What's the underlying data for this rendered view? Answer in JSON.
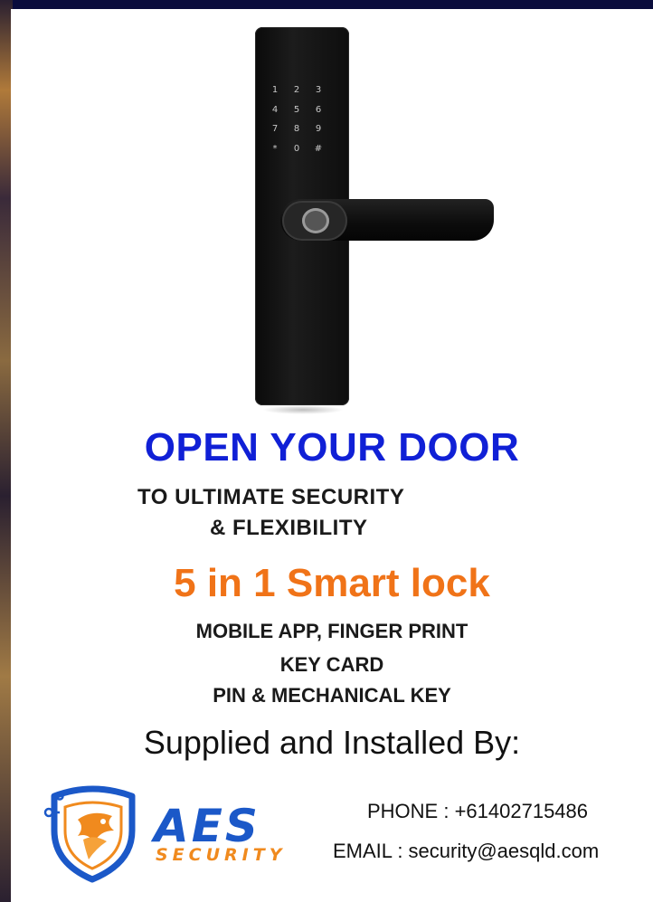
{
  "headline": "OPEN YOUR DOOR",
  "subheadline_line1": "TO ULTIMATE SECURITY",
  "subheadline_line2": "& FLEXIBILITY",
  "product_title": "5 in 1 Smart lock",
  "features": [
    "MOBILE APP, FINGER PRINT",
    "KEY CARD",
    "PIN & MECHANICAL KEY"
  ],
  "supplied_by": "Supplied and Installed By:",
  "logo": {
    "name": "AES",
    "tagline": "SECURITY"
  },
  "contact": {
    "phone": "PHONE : +61402715486",
    "email": "EMAIL : security@aesqld.com"
  },
  "keypad_keys": [
    "1",
    "2",
    "3",
    "4",
    "5",
    "6",
    "7",
    "8",
    "9",
    "*",
    "0",
    "#"
  ],
  "colors": {
    "headline": "#1020d6",
    "product_title": "#f07318",
    "logo_blue": "#1b58c8",
    "logo_orange": "#f08a1e",
    "border": "#0a0c3c"
  }
}
